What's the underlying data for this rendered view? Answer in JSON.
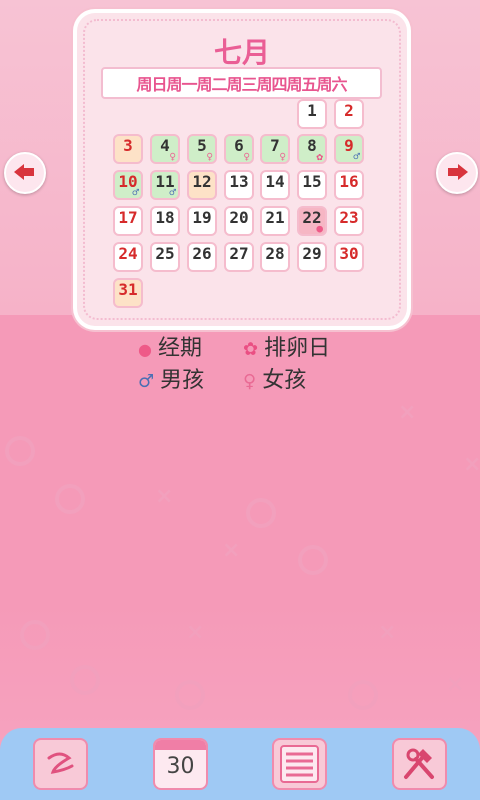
{
  "calendar": {
    "month": "七月",
    "weekdays": "周日周一周二周三周四周五周六",
    "days": [
      "1",
      "2",
      "3",
      "4",
      "5",
      "6",
      "7",
      "8",
      "9",
      "10",
      "11",
      "12",
      "13",
      "14",
      "15",
      "16",
      "17",
      "18",
      "19",
      "20",
      "21",
      "22",
      "23",
      "24",
      "25",
      "26",
      "27",
      "28",
      "29",
      "30",
      "31"
    ]
  },
  "legend": {
    "period": "经期",
    "ovulation": "排卵日",
    "boy": "男孩",
    "girl": "女孩"
  },
  "toolbar": {
    "calendar_day": "30"
  },
  "icons": [
    "prev-arrow-icon",
    "next-arrow-icon",
    "drop-icon",
    "flower-icon",
    "male-icon",
    "female-icon",
    "swirl-icon",
    "calendar-icon",
    "list-icon",
    "tools-icon"
  ],
  "colors": {
    "accent": "#ea5e95",
    "weekend": "#d62b2b",
    "period": "#f6b6c4",
    "fertile": "#cfeec8",
    "safe": "#fde2c7"
  }
}
